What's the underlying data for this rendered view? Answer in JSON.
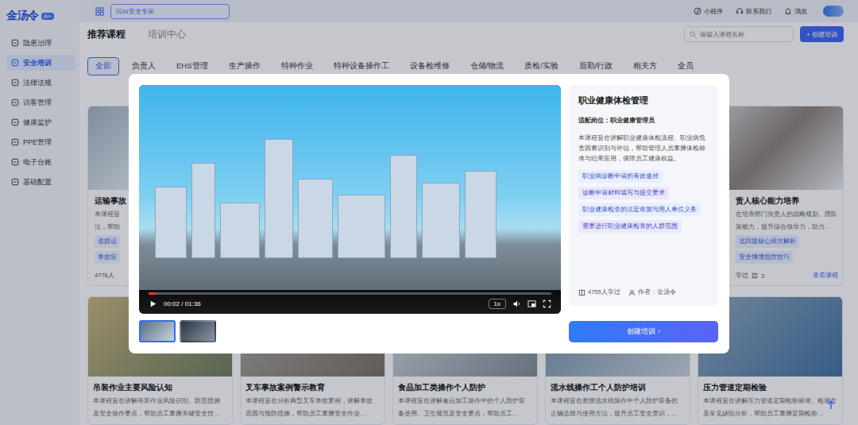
{
  "app": {
    "logo": "金汤令",
    "badge": "AI+"
  },
  "sidebar": {
    "items": [
      {
        "label": "隐患治理",
        "selected": false
      },
      {
        "label": "安全培训",
        "selected": true
      },
      {
        "label": "法律法规",
        "selected": false
      },
      {
        "label": "访客管理",
        "selected": false
      },
      {
        "label": "健康监护",
        "selected": false
      },
      {
        "label": "PPE管理",
        "selected": false
      },
      {
        "label": "电子台账",
        "selected": false
      },
      {
        "label": "基础配置",
        "selected": false
      }
    ]
  },
  "topbar": {
    "search": {
      "placeholder": "问AI安全专家"
    },
    "actions": [
      "小程序",
      "联系我们",
      "消息"
    ]
  },
  "tabs": [
    {
      "label": "推荐课程",
      "selected": true
    },
    {
      "label": "培训中心",
      "selected": false
    }
  ],
  "course_search": {
    "placeholder": "请输入课程名称"
  },
  "create_button": "+ 创建培训",
  "categories": [
    {
      "label": "全部",
      "selected": true
    },
    {
      "label": "负责人",
      "selected": false
    },
    {
      "label": "EHS管理",
      "selected": false
    },
    {
      "label": "生产操作",
      "selected": false
    },
    {
      "label": "特种作业",
      "selected": false
    },
    {
      "label": "特种设备操作工",
      "selected": false
    },
    {
      "label": "设备检维修",
      "selected": false
    },
    {
      "label": "仓储/物流",
      "selected": false
    },
    {
      "label": "质检/实验",
      "selected": false
    },
    {
      "label": "后勤/行政",
      "selected": false
    },
    {
      "label": "相关方",
      "selected": false
    },
    {
      "label": "全员",
      "selected": false
    }
  ],
  "cards_top": [
    {
      "title": "运输事故",
      "desc": [
        "本课程旨",
        "法，帮助"
      ],
      "tags": [
        "道路运",
        "事故应"
      ],
      "learners": "4776人"
    },
    {
      "title": "责人核心能力培养",
      "desc": [
        "在培养部门负责人的战略规划、团队",
        "策能力，提升综合领导力，助力…"
      ],
      "tags": [
        "北回提核心观次解析",
        "安全情境指挥技巧"
      ],
      "learners": "学过",
      "lessons": "3",
      "link": "查看课程"
    }
  ],
  "cards_bottom": [
    {
      "title": "吊装作业主要风险认知",
      "desc": [
        "本课程旨在讲解吊装作业风险识别、防范措施",
        "及安全操作要点，帮助员工掌握关键安全技…"
      ]
    },
    {
      "title": "叉车事故案例警示教育",
      "desc": [
        "本课程旨在分析典型叉车事故案例，讲解事故",
        "原因与预防措施，帮助员工掌握安全作业…"
      ]
    },
    {
      "title": "食品加工类操作个人防护",
      "desc": [
        "本课程旨在讲解食品加工操作中的个人防护装",
        "备使用、卫生规范及安全要点，帮助员工…"
      ]
    },
    {
      "title": "流水线操作工个人防护培训",
      "desc": [
        "本课程旨在教授流水线操作中个人防护装备的",
        "正确选择与使用方法，提升员工安全意识，…"
      ]
    },
    {
      "title": "压力管道定期检验",
      "desc": [
        "本课程旨在讲解压力管道定期检验标准、检测方",
        "及常见缺陷分析，帮助员工掌握定期检验…"
      ]
    }
  ],
  "modal": {
    "player": {
      "time": "00:02 / 01:36",
      "speed": "1x",
      "level": 0.02
    },
    "thumbnails": [
      {
        "selected": true
      },
      {
        "selected": false
      }
    ],
    "course": {
      "title": "职业健康体检管理",
      "role": "适配岗位：职业健康管理员",
      "description": "本课程旨在讲解职业健康体检流程、职业病危害因素识别与评估，帮助管理人员掌握体检标准与结果应用，保障员工健康权益。",
      "tags": [
        {
          "label": "职业病诊断申请的有效途径",
          "color": "#e6effd"
        },
        {
          "label": "诊断申请材料填写与提交要求",
          "color": "#ece8fb"
        },
        {
          "label": "职业健康检查的法定依据与用人单位义务",
          "color": "#e6effd"
        },
        {
          "label": "需要进行职业健康检查的人群范围",
          "color": "#ece8fb"
        }
      ],
      "learners": "4755人学过",
      "author": "作者：金汤令"
    },
    "create_button": "创建培训 ›"
  }
}
